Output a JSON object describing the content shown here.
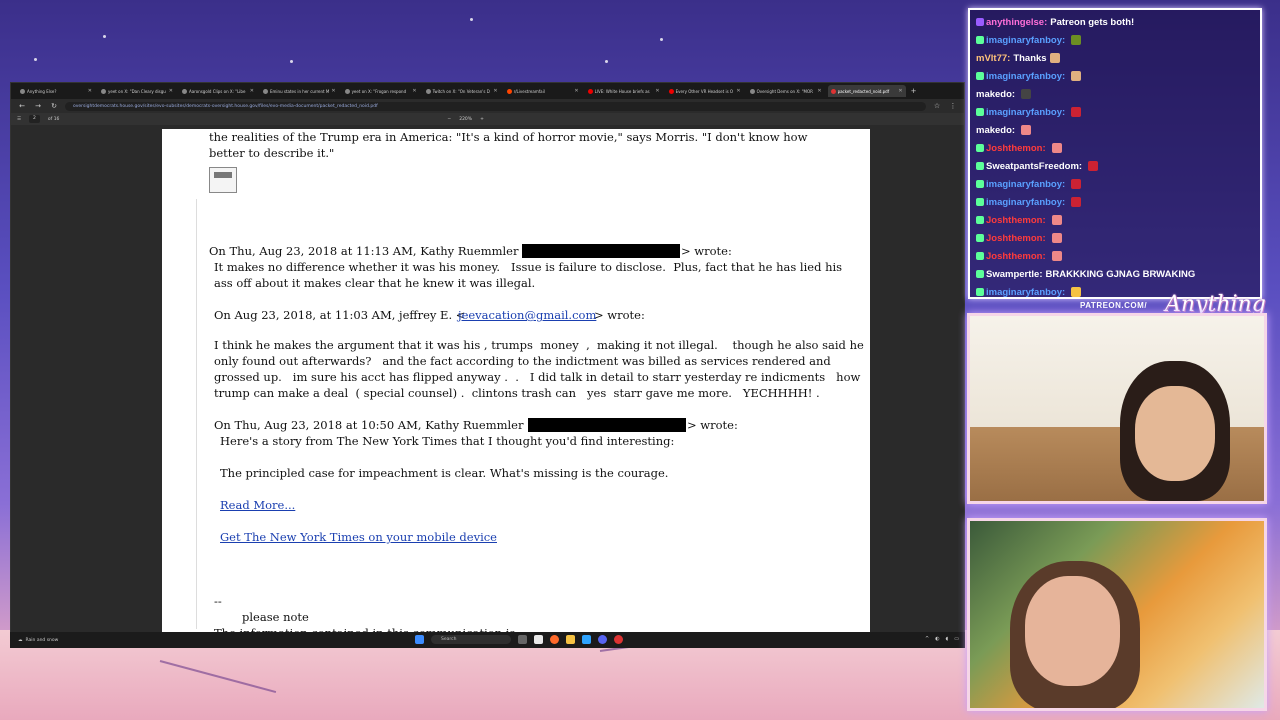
{
  "browser": {
    "tabs": [
      {
        "label": "Anything Else?",
        "active": false
      },
      {
        "label": "yeet on X: \"Dan Cleary disgu",
        "active": false
      },
      {
        "label": "Aaronsgold Clips on X: \"Libe",
        "active": false
      },
      {
        "label": "Eminu states in her current M",
        "active": false
      },
      {
        "label": "yeet on X: \"Frogan respond",
        "active": false
      },
      {
        "label": "Twitch on X: \"On Veteran's D",
        "active": false
      },
      {
        "label": "r/Livestreamfail",
        "active": false
      },
      {
        "label": "LIVE: White House briefs as",
        "active": false
      },
      {
        "label": "Every Other VR Headset is O",
        "active": false
      },
      {
        "label": "Oversight Dems on X: \"MOR",
        "active": false
      },
      {
        "label": "packet_redacted_noid.pdf",
        "active": true
      }
    ],
    "url": "oversightdemocrats.house.gov/sites/evo-subsites/democrats-oversight.house.gov/files/evo-media-document/packet_redacted_noid.pdf",
    "pdf_toolbar": {
      "page_current": "2",
      "page_total": "of 16",
      "zoom": "220%"
    }
  },
  "document": {
    "lines": [
      "the realities of the Trump era in America: \"It's a kind of horror movie,\" says Morris. \"I don't know how",
      "better to describe it.\"",
      "On Thu, Aug 23, 2018 at 11:13 AM, Kathy Ruemmler <",
      "> wrote:",
      "It makes no difference whether it was his money.   Issue is failure to disclose.  Plus, fact that he has lied his",
      "ass off about it makes clear that he knew it was illegal.",
      "On Aug 23, 2018, at 11:03 AM, jeffrey E. <",
      "jeevacation@gmail.com",
      "> wrote:",
      "I think he makes the argument that it was his , trumps  money  ,  making it not illegal.    though he also said he",
      "only found out afterwards?   and the fact according to the indictment was billed as services rendered and",
      "grossed up.   im sure his acct has flipped anyway .  .   I did talk in detail to starr yesterday re indicments   how",
      "trump can make a deal  ( special counsel) .  clintons trash can   yes  starr gave me more.   YECHHHH! .",
      "On Thu, Aug 23, 2018 at 10:50 AM, Kathy Ruemmler <",
      "> wrote:",
      "Here's a story from The New York Times that I thought you'd find interesting:",
      "The principled case for impeachment is clear. What's missing is the courage.",
      "Read More...",
      "Get The New York Times on your mobile device",
      "--",
      "please note",
      "The information contained in this communication is"
    ]
  },
  "taskbar": {
    "weather": "Rain and snow",
    "search_placeholder": "Search"
  },
  "chat": {
    "messages": [
      {
        "user": "anythingelse:",
        "text": "Patreon gets both!",
        "color": "#ff6fd8"
      },
      {
        "user": "imaginaryfanboy:",
        "text": "",
        "color": "#5aa0ff"
      },
      {
        "user": "mVlt77:",
        "text": "Thanks",
        "color": "#ffc37a"
      },
      {
        "user": "imaginaryfanboy:",
        "text": "",
        "color": "#5aa0ff"
      },
      {
        "user": "makedo:",
        "text": "",
        "color": "#ffffff"
      },
      {
        "user": "imaginaryfanboy:",
        "text": "",
        "color": "#5aa0ff"
      },
      {
        "user": "makedo:",
        "text": "",
        "color": "#ffffff"
      },
      {
        "user": "Joshthemon:",
        "text": "",
        "color": "#ff3b3b"
      },
      {
        "user": "SweatpantsFreedom:",
        "text": "",
        "color": "#ffffff"
      },
      {
        "user": "imaginaryfanboy:",
        "text": "",
        "color": "#5aa0ff"
      },
      {
        "user": "imaginaryfanboy:",
        "text": "",
        "color": "#5aa0ff"
      },
      {
        "user": "Joshthemon:",
        "text": "",
        "color": "#ff3b3b"
      },
      {
        "user": "Joshthemon:",
        "text": "",
        "color": "#ff3b3b"
      },
      {
        "user": "Joshthemon:",
        "text": "",
        "color": "#ff3b3b"
      },
      {
        "user": "Swampertle:",
        "text": "BRAKKKING GJNAG BRWAKING",
        "color": "#ffffff"
      },
      {
        "user": "imaginaryfanboy:",
        "text": "",
        "color": "#5aa0ff"
      }
    ]
  },
  "brand": {
    "patreon": "PATREON.COM/",
    "script": "Anything Else?"
  }
}
